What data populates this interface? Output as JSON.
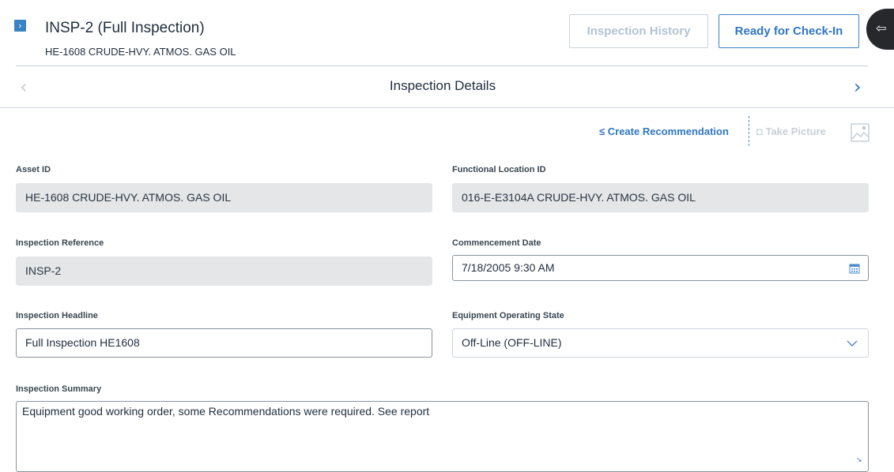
{
  "header": {
    "title": "INSP-2 (Full Inspection)",
    "subtitle": "HE-1608 CRUDE-HVY. ATMOS. GAS OIL",
    "buttons": {
      "history": "Inspection History",
      "checkin": "Ready for Check-In"
    }
  },
  "nav": {
    "section_title": "Inspection Details",
    "prev_icon": "chevron-left-icon",
    "next_icon": "chevron-right-icon"
  },
  "toolbar": {
    "create_recommendation": "Create Recommendation",
    "take_picture": "Take Picture",
    "image_icon": "image-icon"
  },
  "form": {
    "asset_id": {
      "label": "Asset ID",
      "value": "HE-1608 CRUDE-HVY. ATMOS. GAS OIL"
    },
    "functional_location_id": {
      "label": "Functional Location ID",
      "value": "016-E-E3104A CRUDE-HVY. ATMOS. GAS OIL"
    },
    "inspection_reference": {
      "label": "Inspection Reference",
      "value": "INSP-2"
    },
    "commencement_date": {
      "label": "Commencement Date",
      "value": "7/18/2005 9:30 AM"
    },
    "inspection_headline": {
      "label": "Inspection Headline",
      "value": "Full Inspection HE1608"
    },
    "equipment_operating_state": {
      "label": "Equipment Operating State",
      "value": "Off-Line (OFF-LINE)"
    },
    "inspection_summary": {
      "label": "Inspection Summary",
      "value": "Equipment good working order, some Recommendations were required.  See report"
    }
  },
  "colors": {
    "accent": "#2f76c4",
    "disabled": "#b3c3d2",
    "readonly_bg": "#e4e6e8"
  }
}
